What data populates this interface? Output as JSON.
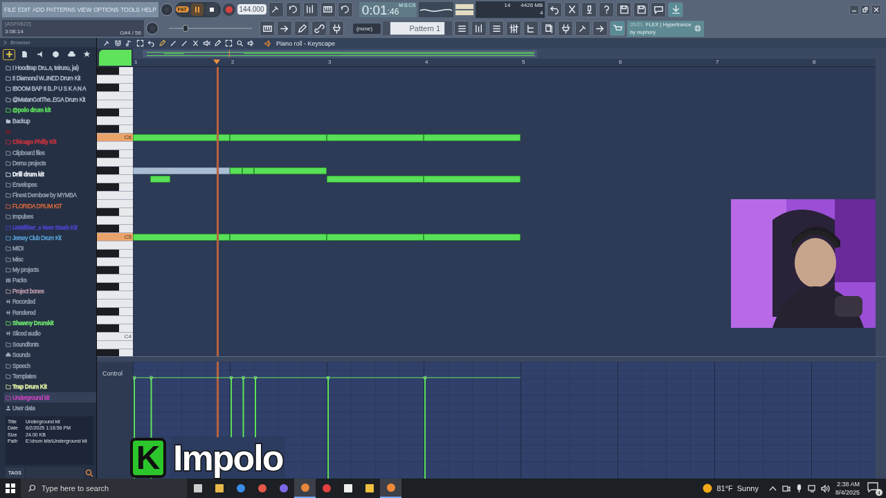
{
  "menu": [
    "FILE",
    "EDIT",
    "ADD",
    "PATTERNS",
    "VIEW",
    "OPTIONS",
    "TOOLS",
    "HELP"
  ],
  "hint": {
    "label": "[ASF0622]",
    "time": "3:08:14",
    "note": "G#4 / 56"
  },
  "transport": {
    "mode": "PAT",
    "tempo": "144.000"
  },
  "clock": {
    "time": "0:01",
    "centi": ":46",
    "unit": "M:S:CS"
  },
  "master_pitch": {
    "level": 0.18
  },
  "monitor": {
    "voices": "14",
    "memory": "4426 MB",
    "polyphony": "4"
  },
  "pattern": {
    "channel": "(none)",
    "name": "Pattern 1"
  },
  "news": {
    "index": "05/21",
    "title": "FLEX | Hypertrance",
    "author": "by nuphory"
  },
  "browser": {
    "title": "Browser",
    "tabs": [
      {
        "selected": true
      },
      {
        "selected": false
      },
      {
        "selected": false
      },
      {
        "selected": false
      },
      {
        "selected": false
      },
      {
        "selected": false
      }
    ],
    "items": [
      {
        "label": "! Hoodtrap Dru..s, teirusu, jai)",
        "kind": "folder",
        "color": "#b7c3d3",
        "bold": false,
        "selected": false
      },
      {
        "label": "!! Diamond W..INED Drum Kit",
        "kind": "folder",
        "color": "#b7c3d3",
        "bold": false,
        "selected": false
      },
      {
        "label": "!BOOM BAP II B..P U S K A N A",
        "kind": "folder",
        "color": "#b7c3d3",
        "bold": false,
        "selected": false
      },
      {
        "label": "@MatanGotThe..EGA Drum Kit",
        "kind": "folder",
        "color": "#b7c3d3",
        "bold": false,
        "selected": false
      },
      {
        "label": "@polo drum kit",
        "kind": "folder",
        "color": "#5ee35e",
        "bold": true,
        "selected": false
      },
      {
        "label": "Backup",
        "kind": "backup",
        "color": "#b7c3d3",
        "bold": false,
        "selected": false
      },
      {
        "kind": "folder",
        "color": "#5a2430",
        "selected": false
      },
      {
        "label": "Chicago Philly Kit",
        "kind": "folder",
        "color": "#c8323e",
        "bold": true,
        "selected": false
      },
      {
        "label": "Clipboard files",
        "kind": "folder",
        "color": "#9aa6b6",
        "bold": false,
        "selected": false
      },
      {
        "label": "Demo projects",
        "kind": "folder",
        "color": "#9aa6b6",
        "bold": false,
        "selected": false
      },
      {
        "label": "Drill drum kit",
        "kind": "folder",
        "color": "#eef2f8",
        "bold": true,
        "selected": false
      },
      {
        "label": "Envelopes",
        "kind": "folder",
        "color": "#9aa6b6",
        "bold": false,
        "selected": false
      },
      {
        "label": "Finest Dembow by MYMBA",
        "kind": "folder",
        "color": "#9aa6b6",
        "bold": false,
        "selected": false
      },
      {
        "label": "FLORIDA DRUM KIT",
        "kind": "folder",
        "color": "#e06a3c",
        "bold": false,
        "selected": false
      },
      {
        "label": "Impulses",
        "kind": "folder",
        "color": "#9aa6b6",
        "bold": false,
        "selected": false
      },
      {
        "label": "UsWither_s New Stash Kit",
        "kind": "folder",
        "color": "#4a44c8",
        "bold": true,
        "selected": false
      },
      {
        "label": "Jersey Club Drum Kit",
        "kind": "folder",
        "color": "#5ca8e0",
        "bold": false,
        "selected": false
      },
      {
        "label": "MIDI",
        "kind": "folder",
        "color": "#9aa6b6",
        "bold": false,
        "selected": false
      },
      {
        "label": "Misc",
        "kind": "folder",
        "color": "#9aa6b6",
        "bold": false,
        "selected": false
      },
      {
        "label": "My projects",
        "kind": "folder",
        "color": "#9aa6b6",
        "bold": false,
        "selected": false
      },
      {
        "label": "Packs",
        "kind": "packs",
        "color": "#9aa6b6",
        "bold": false,
        "selected": false
      },
      {
        "label": "Project bones",
        "kind": "folder",
        "color": "#c9a3b3",
        "bold": false,
        "selected": false
      },
      {
        "label": "Recorded",
        "kind": "audio",
        "color": "#9aa6b6",
        "bold": false,
        "selected": false
      },
      {
        "label": "Rendered",
        "kind": "audio",
        "color": "#9aa6b6",
        "bold": false,
        "selected": false
      },
      {
        "label": "Shawny Drumkit",
        "kind": "folder",
        "color": "#6ee26e",
        "bold": true,
        "selected": false
      },
      {
        "label": "Sliced audio",
        "kind": "audio",
        "color": "#9aa6b6",
        "bold": false,
        "selected": false
      },
      {
        "label": "Soundfonts",
        "kind": "folder",
        "color": "#9aa6b6",
        "bold": false,
        "selected": false
      },
      {
        "label": "Sounds",
        "kind": "cloud",
        "color": "#9aa6b6",
        "bold": false,
        "selected": false
      },
      {
        "label": "Speech",
        "kind": "folder",
        "color": "#9aa6b6",
        "bold": false,
        "selected": false
      },
      {
        "label": "Templates",
        "kind": "folder",
        "color": "#9aa6b6",
        "bold": false,
        "selected": false
      },
      {
        "label": "Trap Drum Kit",
        "kind": "folder",
        "color": "#e2f2a4",
        "bold": true,
        "selected": false
      },
      {
        "label": "Underground kit",
        "kind": "folder",
        "color": "#d444c4",
        "bold": false,
        "selected": true
      },
      {
        "label": "User data",
        "kind": "user",
        "color": "#9aa6b6",
        "bold": false,
        "selected": false
      }
    ],
    "info": [
      {
        "key": "Title",
        "value": "Underground kit"
      },
      {
        "key": "Date",
        "value": "6/2/2025 1:16:56 PM"
      },
      {
        "key": "Size",
        "value": "24.00 KB"
      },
      {
        "key": "Path",
        "value": "E:\\drum kits\\Underground kit"
      }
    ],
    "tags": "TAGS"
  },
  "piano_roll": {
    "title": "Piano roll - Keyscape",
    "bars": [
      "1",
      "2",
      "3",
      "4",
      "5",
      "6",
      "7",
      "8"
    ],
    "playhead": {
      "level": 0.113
    },
    "keys": [
      {
        "label": "C6",
        "highlighted": true
      },
      {
        "label": "C5",
        "highlighted": true
      },
      {
        "label": "C4",
        "highlighted": false
      }
    ],
    "notes": [
      {
        "muted": false
      },
      {
        "muted": false
      },
      {
        "muted": false
      },
      {
        "muted": false
      },
      {
        "muted": true
      },
      {
        "muted": false
      },
      {
        "muted": false
      },
      {
        "muted": false
      },
      {
        "muted": false
      },
      {
        "muted": false
      },
      {
        "muted": false
      },
      {
        "muted": false
      },
      {
        "muted": false
      },
      {
        "muted": false
      },
      {
        "muted": false
      }
    ],
    "control_label": "Control"
  },
  "logo": {
    "letter": "K",
    "name": "Impolo"
  },
  "taskbar": {
    "search_placeholder": "Type here to search",
    "apps": [
      {
        "active": false
      },
      {
        "active": false
      },
      {
        "active": false
      },
      {
        "active": false
      },
      {
        "active": false
      },
      {
        "active": true
      },
      {
        "active": false
      },
      {
        "active": false
      },
      {
        "active": false
      },
      {
        "active": true
      }
    ],
    "temperature": "81°F",
    "weather": "Sunny",
    "time": "2:38 AM",
    "date": "8/4/2025",
    "notifications": "4"
  }
}
